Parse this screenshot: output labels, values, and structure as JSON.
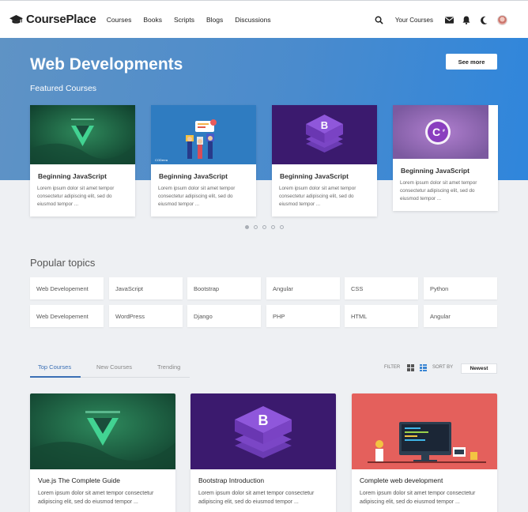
{
  "header": {
    "brand": "CoursePlace",
    "nav": [
      "Courses",
      "Books",
      "Scripts",
      "Blogs",
      "Discussions"
    ],
    "your_courses": "Your Courses"
  },
  "hero": {
    "title": "Web Developments",
    "subtitle": "Featured Courses",
    "see_more": "See more"
  },
  "featured": [
    {
      "title": "Beginning JavaScript",
      "desc": "Lorem ipsum dolor sit amet tempor consectetur adipiscing elit, sed do eiusmod tempor ...",
      "thumb": "vue"
    },
    {
      "title": "Beginning JavaScript",
      "desc": "Lorem ipsum dolor sit amet tempor consectetur adipiscing elit, sed do eiusmod tempor ...",
      "thumb": "teamwork",
      "thumb_label": "CODerra"
    },
    {
      "title": "Beginning JavaScript",
      "desc": "Lorem ipsum dolor sit amet tempor consectetur adipiscing elit, sed do eiusmod tempor ...",
      "thumb": "bootstrap"
    },
    {
      "title": "Beginning JavaScript",
      "desc": "Lorem ipsum dolor sit amet tempor consectetur adipiscing elit, sed do eiusmod tempor ...",
      "thumb": "csharp"
    }
  ],
  "carousel": {
    "count": 5,
    "active": 0
  },
  "popular": {
    "title": "Popular topics",
    "row1": [
      "Web Developement",
      "JavaScript",
      "Bootstrap",
      "Angular",
      "CSS",
      "Python"
    ],
    "row2": [
      "Web Developement",
      "WordPress",
      "Django",
      "PHP",
      "HTML",
      "Angular"
    ]
  },
  "tabs": [
    "Top Courses",
    "New Courses",
    "Trending"
  ],
  "filters": {
    "filter": "FILTER",
    "sort_by": "SORT BY",
    "sort_value": "Newest"
  },
  "courses": [
    {
      "title": "Vue.js The Complete Guide",
      "desc": "Lorem ipsum dolor sit amet tempor consectetur adipiscing elit, sed do eiusmod tempor ...",
      "thumb": "vue"
    },
    {
      "title": "Bootstrap Introduction",
      "desc": "Lorem ipsum dolor sit amet tempor consectetur adipiscing elit, sed do eiusmod tempor ...",
      "thumb": "bootstrap"
    },
    {
      "title": "Complete web development",
      "desc": "Lorem ipsum dolor sit amet tempor consectetur adipiscing elit, sed do eiusmod tempor ...",
      "thumb": "workspace"
    }
  ],
  "colors": {
    "accent": "#3a6fb5",
    "hero_start": "#5f93c5",
    "hero_end": "#2f86dc"
  }
}
